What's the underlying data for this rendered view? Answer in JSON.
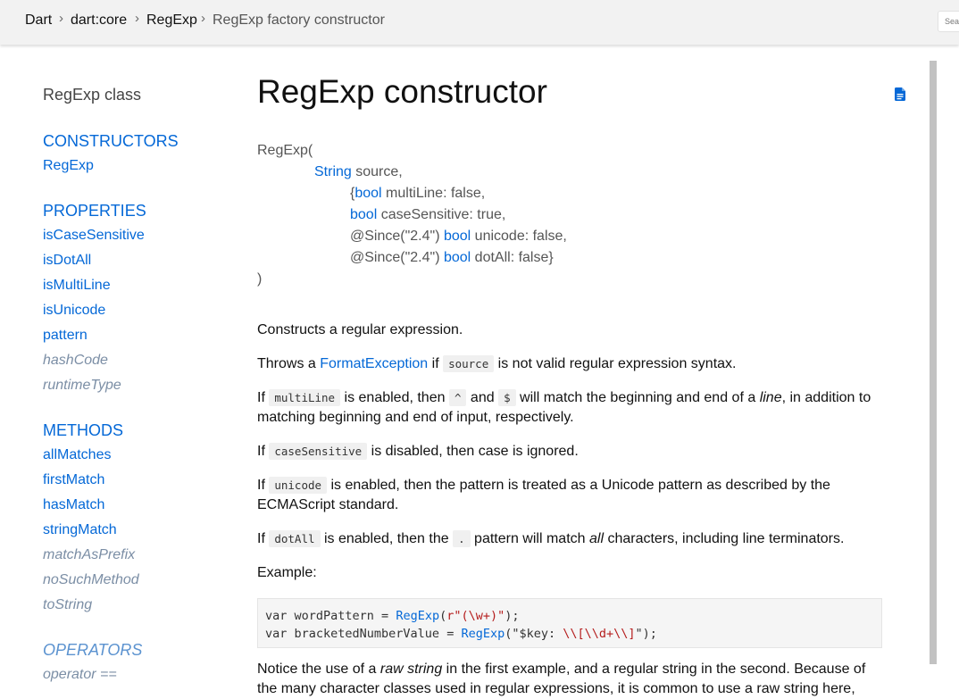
{
  "breadcrumb": {
    "items": [
      "Dart",
      "dart:core",
      "RegExp",
      "RegExp factory constructor"
    ],
    "separator": "›"
  },
  "search": {
    "placeholder": "Search"
  },
  "sidebar": {
    "title": "RegExp class",
    "sections": {
      "constructors": {
        "heading": "CONSTRUCTORS",
        "items": [
          "RegExp"
        ]
      },
      "properties": {
        "heading": "PROPERTIES",
        "items": [
          "isCaseSensitive",
          "isDotAll",
          "isMultiLine",
          "isUnicode",
          "pattern",
          "hashCode",
          "runtimeType"
        ]
      },
      "methods": {
        "heading": "METHODS",
        "items": [
          "allMatches",
          "firstMatch",
          "hasMatch",
          "stringMatch",
          "matchAsPrefix",
          "noSuchMethod",
          "toString"
        ]
      },
      "operators": {
        "heading": "OPERATORS",
        "items": [
          "operator =="
        ]
      }
    }
  },
  "main": {
    "title": "RegExp constructor",
    "source_icon": "document-icon",
    "signature": {
      "open": "RegExp(",
      "param1_type": "String",
      "param1_rest": " source,",
      "p2_pre": "{",
      "p2_type": "bool",
      "p2_rest": " multiLine: false,",
      "p3_type": "bool",
      "p3_rest": " caseSensitive: true,",
      "p4_pre": "@Since(\"2.4\") ",
      "p4_type": "bool",
      "p4_rest": " unicode: false,",
      "p5_pre": "@Since(\"2.4\") ",
      "p5_type": "bool",
      "p5_rest": " dotAll: false}",
      "close": ")"
    },
    "p1": "Constructs a regular expression.",
    "p2": {
      "a": "Throws a ",
      "link": "FormatException",
      "b": " if ",
      "code": "source",
      "c": " is not valid regular expression syntax."
    },
    "p3": {
      "a": "If ",
      "code1": "multiLine",
      "b": " is enabled, then ",
      "code2": "^",
      "c": " and ",
      "code3": "$",
      "d": " will match the beginning and end of a ",
      "em": "line",
      "e": ", in addition to matching beginning and end of input, respectively."
    },
    "p4": {
      "a": "If ",
      "code": "caseSensitive",
      "b": " is disabled, then case is ignored."
    },
    "p5": {
      "a": "If ",
      "code": "unicode",
      "b": " is enabled, then the pattern is treated as a Unicode pattern as described by the ECMAScript standard."
    },
    "p6": {
      "a": "If ",
      "code1": "dotAll",
      "b": " is enabled, then the ",
      "code2": ".",
      "c": " pattern will match ",
      "em": "all",
      "d": " characters, including line terminators."
    },
    "example_label": "Example:",
    "code": {
      "l1_a": "var wordPattern = ",
      "l1_cls": "RegExp",
      "l1_b": "(",
      "l1_str": "r\"(\\w+)\"",
      "l1_c": ");",
      "l2_a": "var bracketedNumberValue = ",
      "l2_cls": "RegExp",
      "l2_b": "(\"$key: ",
      "l2_str": "\\\\[\\\\d+\\\\]",
      "l2_c": "\");"
    },
    "p7": {
      "a": "Notice the use of a ",
      "em": "raw string",
      "b": " in the first example, and a regular string in the second. Because of the many character classes used in regular expressions, it is common to use a raw string here,"
    }
  }
}
